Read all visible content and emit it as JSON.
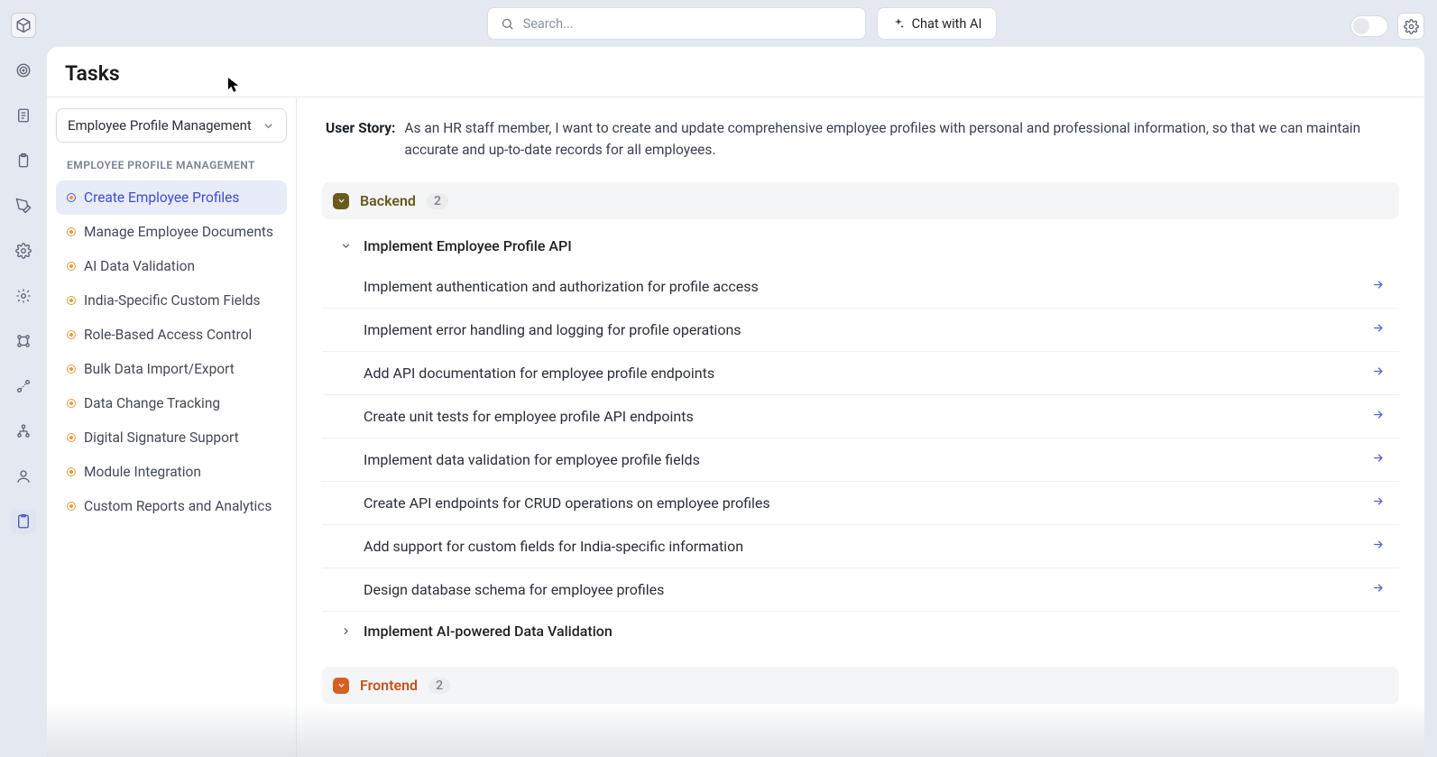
{
  "search": {
    "placeholder": "Search..."
  },
  "chat_ai_label": "Chat with AI",
  "page_title": "Tasks",
  "module_selector": {
    "label": "Employee Profile Management"
  },
  "sidebar": {
    "section_label": "EMPLOYEE PROFILE MANAGEMENT",
    "items": [
      {
        "label": "Create Employee Profiles"
      },
      {
        "label": "Manage Employee Documents"
      },
      {
        "label": "AI Data Validation"
      },
      {
        "label": "India-Specific Custom Fields"
      },
      {
        "label": "Role-Based Access Control"
      },
      {
        "label": "Bulk Data Import/Export"
      },
      {
        "label": "Data Change Tracking"
      },
      {
        "label": "Digital Signature Support"
      },
      {
        "label": "Module Integration"
      },
      {
        "label": "Custom Reports and Analytics"
      }
    ]
  },
  "user_story": {
    "label": "User Story:",
    "text": "As an HR staff member, I want to create and update comprehensive employee profiles with personal and professional information, so that we can maintain accurate and up-to-date records for all employees."
  },
  "groups": {
    "backend": {
      "title": "Backend",
      "count": "2"
    },
    "frontend": {
      "title": "Frontend",
      "count": "2"
    }
  },
  "task_parents": {
    "p1": "Implement Employee Profile API",
    "p2": "Implement AI-powered Data Validation"
  },
  "tasks": [
    "Implement authentication and authorization for profile access",
    "Implement error handling and logging for profile operations",
    "Add API documentation for employee profile endpoints",
    "Create unit tests for employee profile API endpoints",
    "Implement data validation for employee profile fields",
    "Create API endpoints for CRUD operations on employee profiles",
    "Add support for custom fields for India-specific information",
    "Design database schema for employee profiles"
  ]
}
